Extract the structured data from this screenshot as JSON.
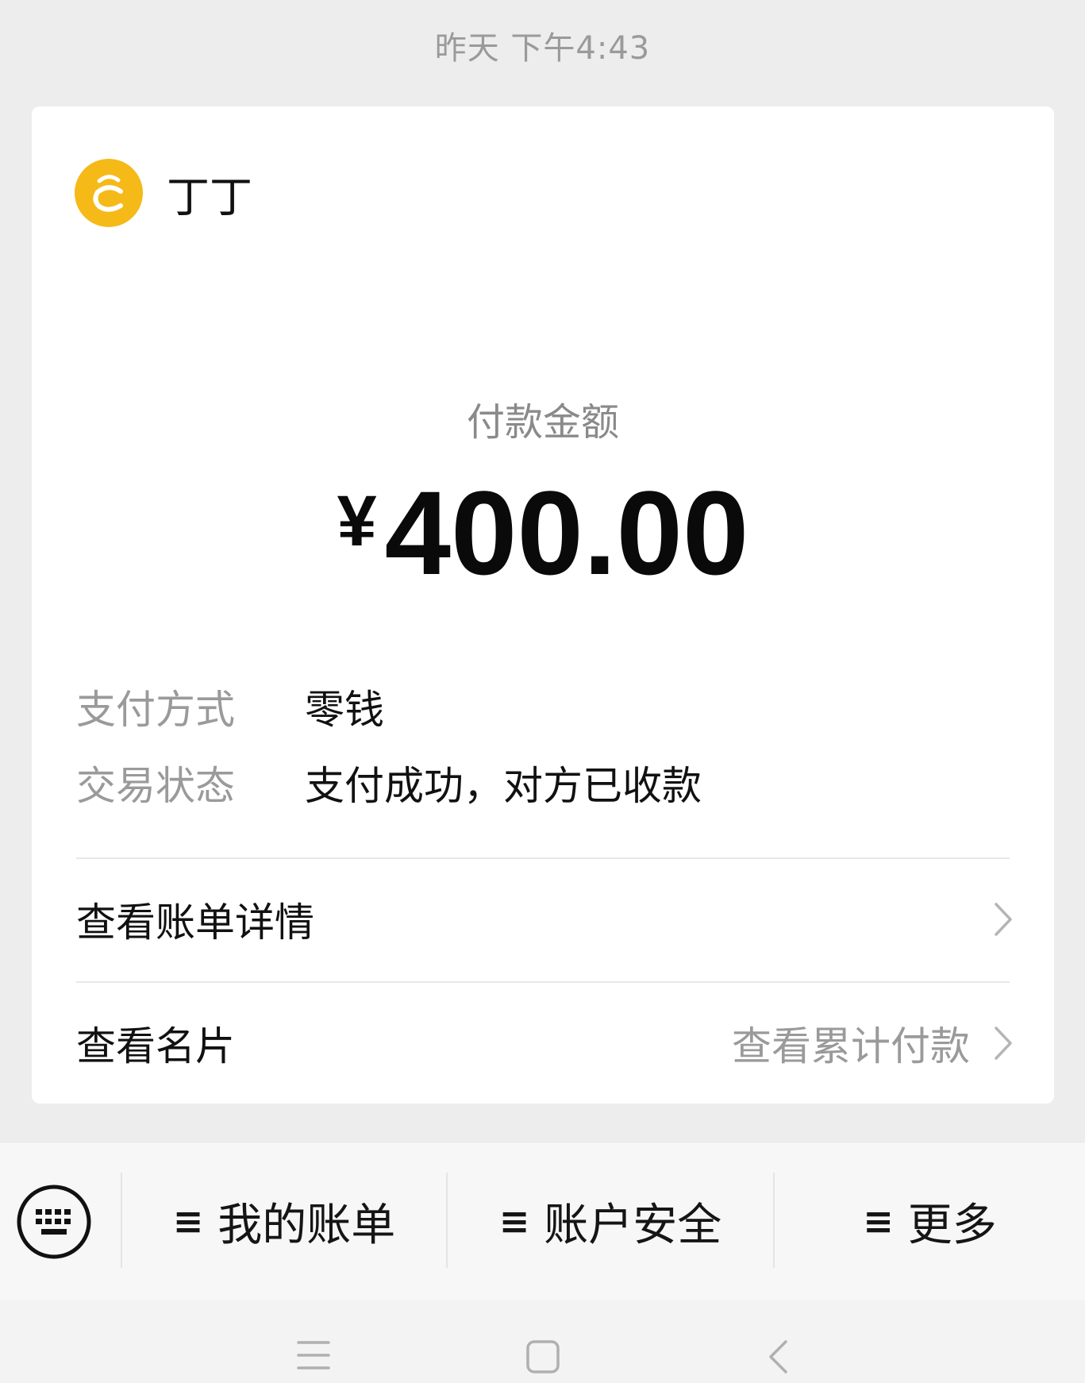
{
  "timestamp": "昨天 下午4:43",
  "merchant": {
    "name": "丁丁",
    "logo_icon": "merchant-logo-icon",
    "logo_color": "#f5b918"
  },
  "payment": {
    "amount_label": "付款金额",
    "currency": "¥",
    "amount": "400.00"
  },
  "details": {
    "method_label": "支付方式",
    "method_value": "零钱",
    "status_label": "交易状态",
    "status_value": "支付成功，对方已收款"
  },
  "links": {
    "bill_details": "查看账单详情",
    "business_card": "查看名片",
    "cumulative_payment": "查看累计付款"
  },
  "menu": {
    "keyboard_icon": "keyboard-icon",
    "items": [
      {
        "label": "我的账单",
        "icon": "≡"
      },
      {
        "label": "账户安全",
        "icon": "≡"
      },
      {
        "label": "更多",
        "icon": "≡"
      }
    ]
  },
  "system_nav": {
    "icons": [
      "menu-icon",
      "home-icon",
      "back-icon"
    ]
  }
}
